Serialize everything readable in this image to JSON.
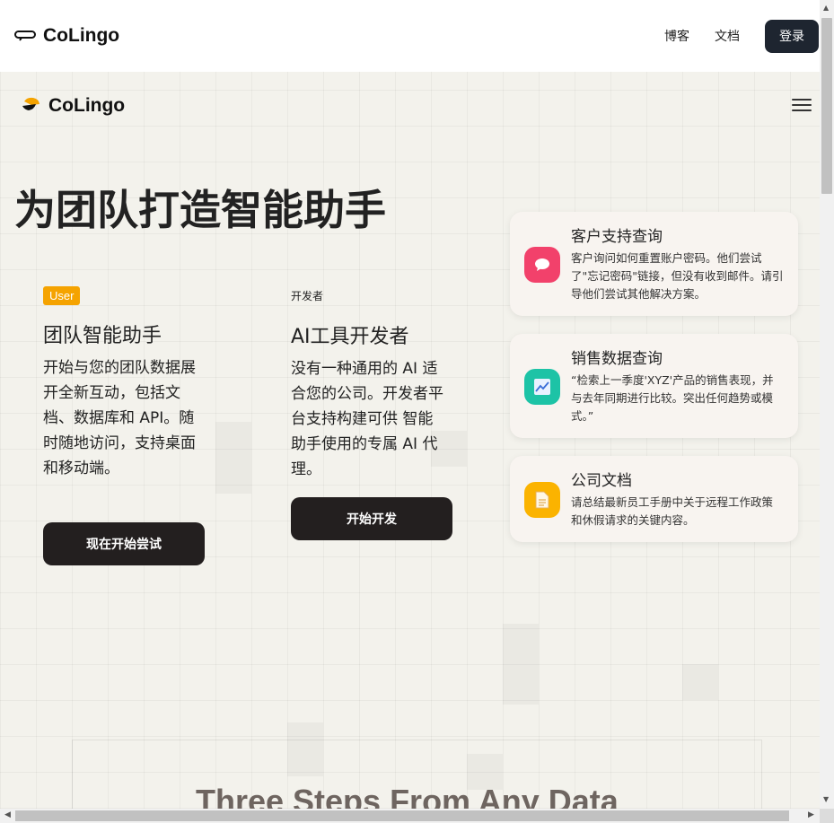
{
  "topbar": {
    "brand": "CoLingo",
    "links": [
      "博客",
      "文档"
    ],
    "login": "登录"
  },
  "hero": {
    "brand": "CoLingo",
    "title": "为团队打造智能助手"
  },
  "user_column": {
    "badge": "User",
    "title": "团队智能助手",
    "description": "开始与您的团队数据展开全新互动，包括文档、数据库和 API。随时随地访问，支持桌面和移动端。",
    "cta": "现在开始尝试"
  },
  "dev_column": {
    "label": "开发者",
    "title": "AI工具开发者",
    "description": "没有一种通用的 AI 适合您的公司。开发者平台支持构建可供 智能助手使用的专属 AI 代理。",
    "cta": "开始开发"
  },
  "cards": [
    {
      "title": "客户支持查询",
      "text": "客户询问如何重置账户密码。他们尝试了\"忘记密码\"链接，但没有收到邮件。请引导他们尝试其他解决方案。",
      "icon": "chat-bubble-icon",
      "color": "#f2416b"
    },
    {
      "title": "销售数据查询",
      "text": "“检索上一季度'XYZ'产品的销售表现，并与去年同期进行比较。突出任何趋势或模式。”",
      "icon": "chart-icon",
      "color": "#1dc3a6"
    },
    {
      "title": "公司文档",
      "text": "请总结最新员工手册中关于远程工作政策和休假请求的关键内容。",
      "icon": "document-icon",
      "color": "#fbb300"
    }
  ],
  "section": {
    "title": "Three Steps From Any Data"
  }
}
